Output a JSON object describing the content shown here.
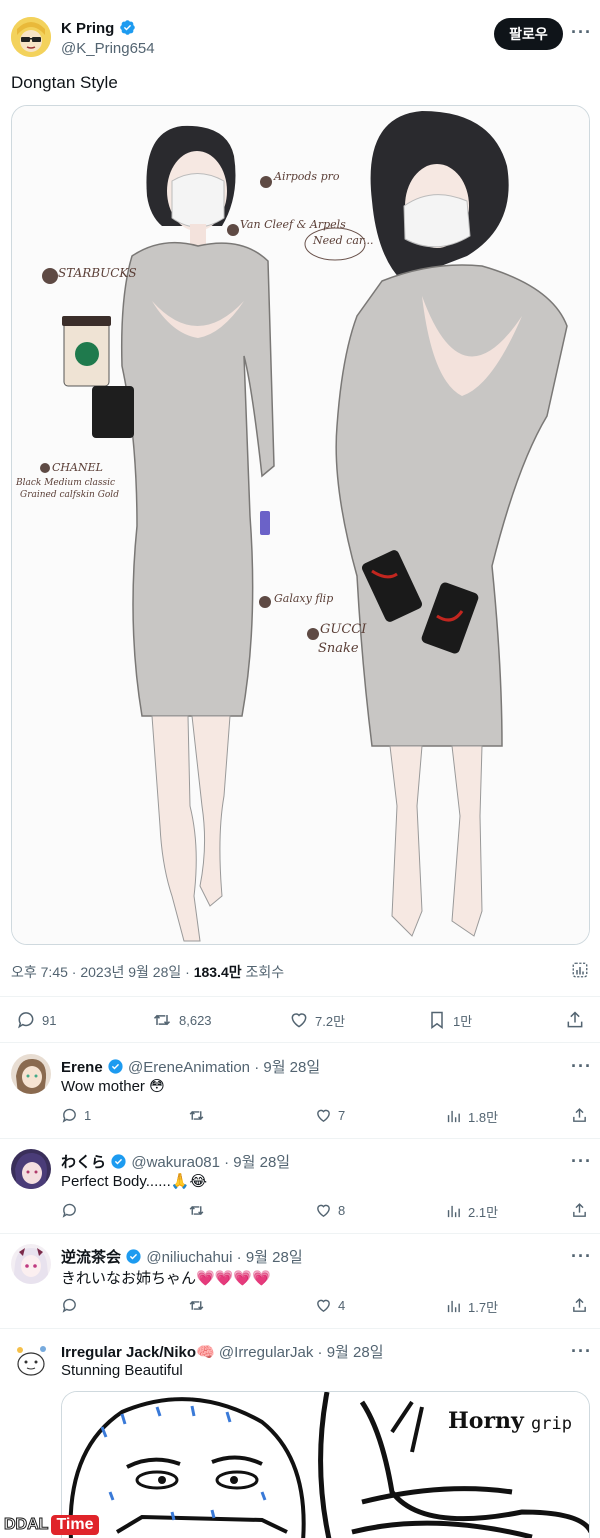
{
  "tweet": {
    "author_name": "K Pring",
    "author_handle": "@K_Pring654",
    "follow_label": "팔로우",
    "more_label": "···",
    "text": "Dongtan Style",
    "meta_time_date": "오후 7:45 · 2023년 9월 28일 · ",
    "meta_views": "183.4만",
    "meta_views_label": " 조회수",
    "stats": {
      "replies": "91",
      "retweets": "8,623",
      "likes": "7.2만",
      "bookmarks": "1만"
    },
    "image_notes": {
      "airpods": "Airpods pro",
      "vancleef": "Van Cleef & Arpels",
      "starbucks": "STARBUCKS",
      "needcar": "Need car...",
      "chanel": "CHANEL",
      "chanel_desc1": "Black Medium classic",
      "chanel_desc2": "Grained calfskin Gold",
      "galaxy": "Galaxy flip",
      "gucci1": "GUCCI",
      "gucci2": "Snake"
    }
  },
  "replies": [
    {
      "name": "Erene",
      "handle": "@EreneAnimation",
      "date": "· 9월 28일",
      "text": "Wow mother 😳",
      "replies": "1",
      "retweets": "",
      "likes": "7",
      "views": "1.8만",
      "verified": true
    },
    {
      "name": "わくら",
      "handle": "@wakura081",
      "date": "· 9월 28일",
      "text": "Perfect Body......🙏😂",
      "replies": "",
      "retweets": "",
      "likes": "8",
      "views": "2.1만",
      "verified": true
    },
    {
      "name": "逆流茶会",
      "handle": "@niliuchahui",
      "date": "· 9월 28일",
      "text": "きれいなお姉ちゃん💗💗💗💗",
      "replies": "",
      "retweets": "",
      "likes": "4",
      "views": "1.7만",
      "verified": true
    },
    {
      "name": "Irregular Jack/Niko🧠",
      "handle": "@IrregularJak",
      "date": "· 9월 28일",
      "text": "Stunning Beautiful",
      "verified": false
    }
  ],
  "meme": {
    "caption1": "Horny",
    "caption2": "grip"
  },
  "watermark": {
    "part1": "DDAL",
    "part2": "Time"
  },
  "colors": {
    "verified": "#1d9bf0",
    "muted": "#536471",
    "like_pink": "#f4879a"
  }
}
